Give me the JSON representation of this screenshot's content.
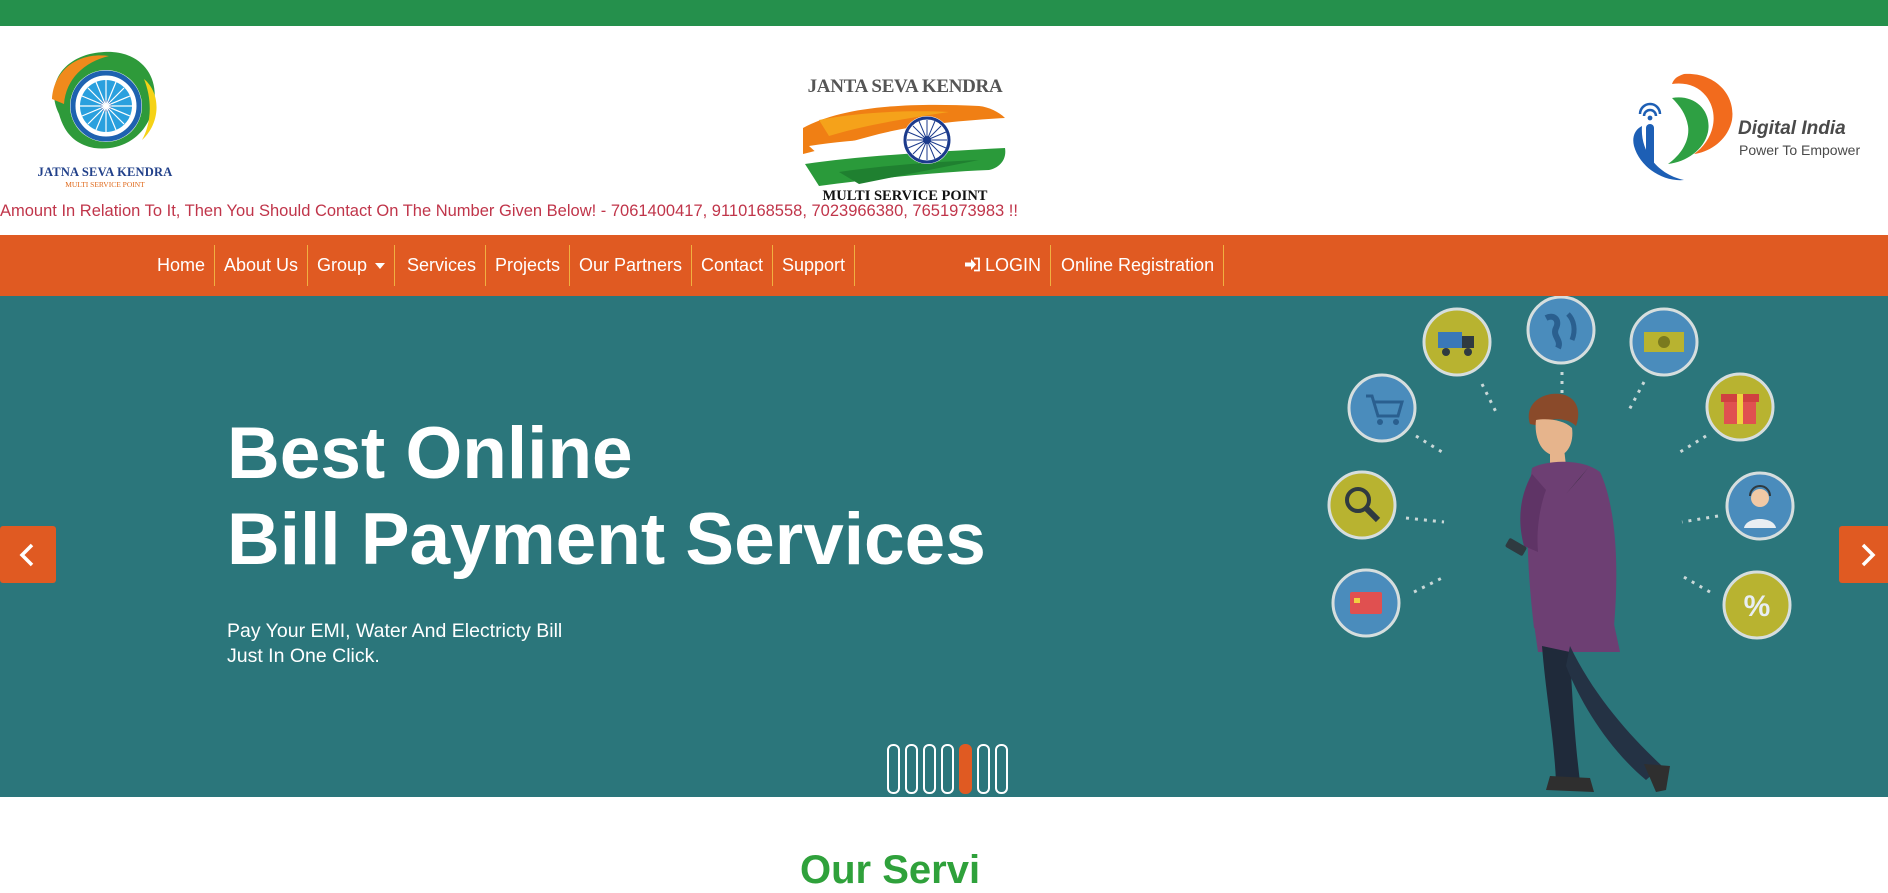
{
  "header": {
    "left_logo": {
      "title": "JATNA SEVA KENDRA",
      "subtitle": "MULTI SERVICE POINT"
    },
    "center_logo": {
      "title": "JANTA SEVA KENDRA",
      "subtitle": "MULTI SERVICE POINT"
    },
    "right_logo": {
      "title": "Digital India",
      "subtitle": "Power To Empower"
    }
  },
  "marquee": "Amount In Relation To It, Then You Should Contact On The Number Given Below! - 7061400417, 9110168558, 7023966380, 7651973983 !!",
  "nav": {
    "items": [
      {
        "label": "Home"
      },
      {
        "label": "About Us"
      },
      {
        "label": "Group"
      },
      {
        "label": "Services"
      },
      {
        "label": "Projects"
      },
      {
        "label": "Our Partners"
      },
      {
        "label": "Contact"
      },
      {
        "label": "Support"
      }
    ],
    "login_label": "LOGIN",
    "registration_label": "Online Registration"
  },
  "hero": {
    "title_line1": "Best Online",
    "title_line2": "Bill Payment Services",
    "desc_line1": "Pay Your EMI, Water And Electricty Bill",
    "desc_line2": "Just In One Click.",
    "slide_count": 7,
    "active_slide": 5
  },
  "section": {
    "heading_partial": "Our Servi"
  },
  "colors": {
    "topbar": "#25904c",
    "nav": "#e05a22",
    "hero_bg": "#2b767b",
    "marquee_text": "#c0354a",
    "accent_green": "#2fa13b"
  },
  "icons": [
    "truck-icon",
    "globe-icon",
    "money-icon",
    "cart-icon",
    "gift-icon",
    "search-icon",
    "support-agent-icon",
    "credit-card-icon",
    "percent-icon",
    "login-icon",
    "chevron-left-icon",
    "chevron-right-icon"
  ]
}
